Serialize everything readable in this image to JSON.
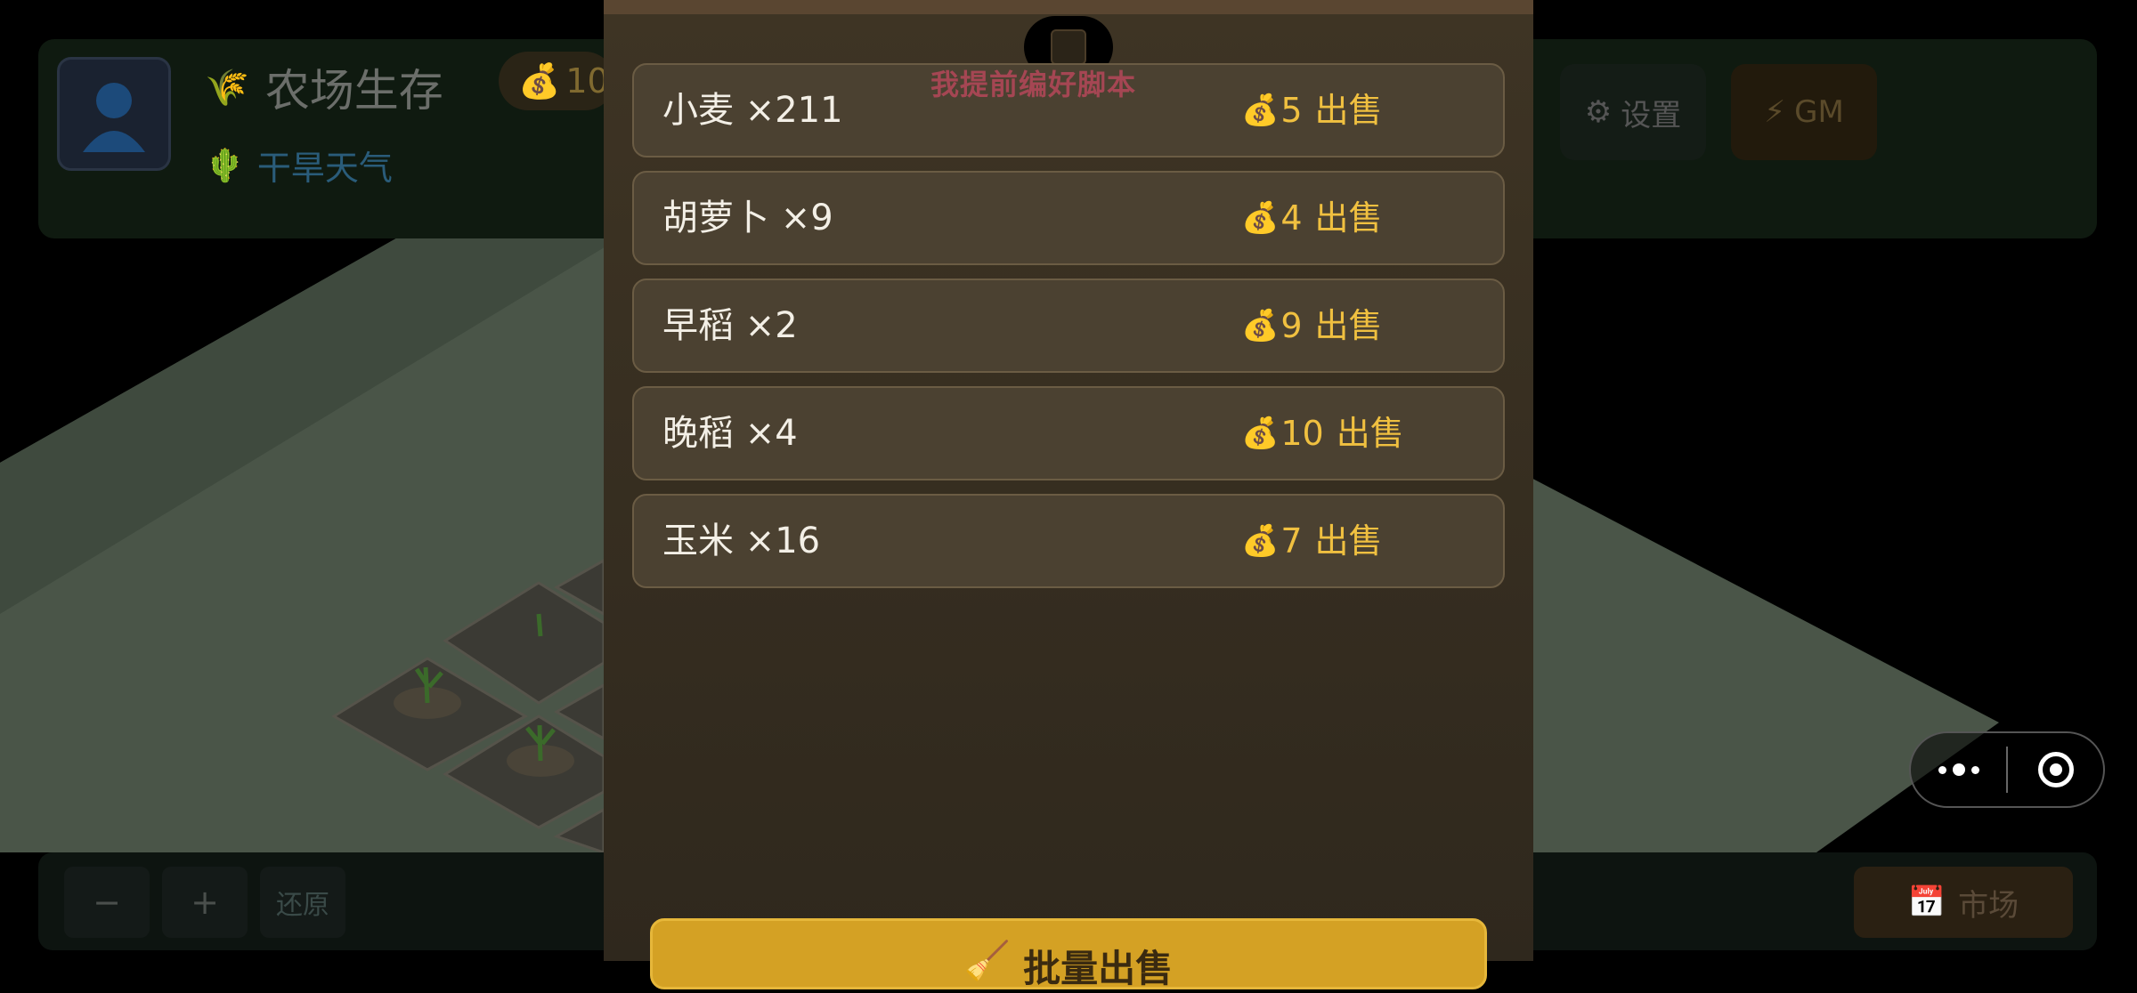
{
  "header": {
    "title": "农场生存",
    "title_icon": "wheat-icon",
    "coins_partial": "10",
    "weather_label": "干旱天气",
    "weather_icon": "cactus-icon",
    "settings_label": "设置",
    "gm_label": "GM"
  },
  "bottom_bar": {
    "zoom_out_label": "−",
    "zoom_in_label": "+",
    "reset_label": "还原",
    "market_label": "市场",
    "market_icon": "calendar-icon"
  },
  "watermark": "我提前编好脚本",
  "sell_panel": {
    "items": [
      {
        "name": "小麦 ×211",
        "price": "5",
        "action": "出售"
      },
      {
        "name": "胡萝卜 ×9",
        "price": "4",
        "action": "出售"
      },
      {
        "name": "早稻 ×2",
        "price": "9",
        "action": "出售"
      },
      {
        "name": "晚稻 ×4",
        "price": "10",
        "action": "出售"
      },
      {
        "name": "玉米 ×16",
        "price": "7",
        "action": "出售"
      }
    ],
    "sell_all_label": "批量出售",
    "sell_all_icon": "broom-icon",
    "coin_icon": "money-bag-icon"
  },
  "colors": {
    "modal_bg": "#3a3022",
    "row_bg": "#4b4131",
    "price_text": "#f0c040",
    "sell_all_bg": "#d4a124",
    "watermark": "#b5485a"
  }
}
